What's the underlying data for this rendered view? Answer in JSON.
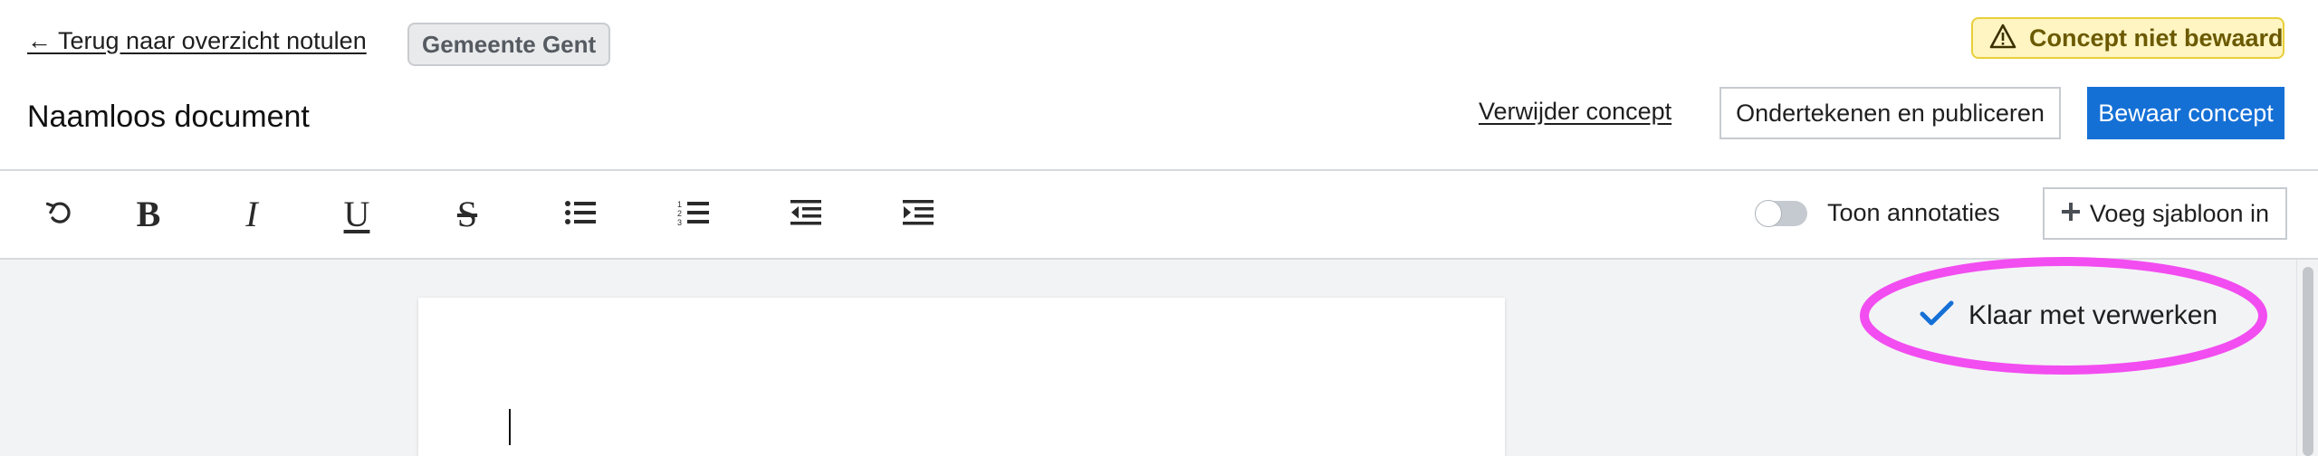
{
  "header": {
    "back_link": "← Terug naar overzicht notulen",
    "organization": "Gemeente Gent",
    "document_title": "Naamloos document",
    "warning": "Concept niet bewaard",
    "delete_label": "Verwijder concept",
    "sign_publish_label": "Ondertekenen en publiceren",
    "save_label": "Bewaar concept"
  },
  "toolbar": {
    "tools": [
      {
        "name": "undo-icon"
      },
      {
        "name": "bold-icon",
        "glyph": "B"
      },
      {
        "name": "italic-icon",
        "glyph": "I"
      },
      {
        "name": "underline-icon",
        "glyph": "U"
      },
      {
        "name": "strikethrough-icon",
        "glyph": "S"
      },
      {
        "name": "unordered-list-icon"
      },
      {
        "name": "ordered-list-icon"
      },
      {
        "name": "outdent-icon"
      },
      {
        "name": "indent-icon"
      }
    ],
    "toggle_label": "Toon annotaties",
    "toggle_on": false,
    "insert_template_label": "Voeg sjabloon in"
  },
  "status": {
    "label": "Klaar met verwerken"
  },
  "colors": {
    "primary": "#1570d6",
    "warning_bg": "#fff5c2",
    "warning_text": "#6b5a00",
    "highlight": "#f24df0"
  }
}
